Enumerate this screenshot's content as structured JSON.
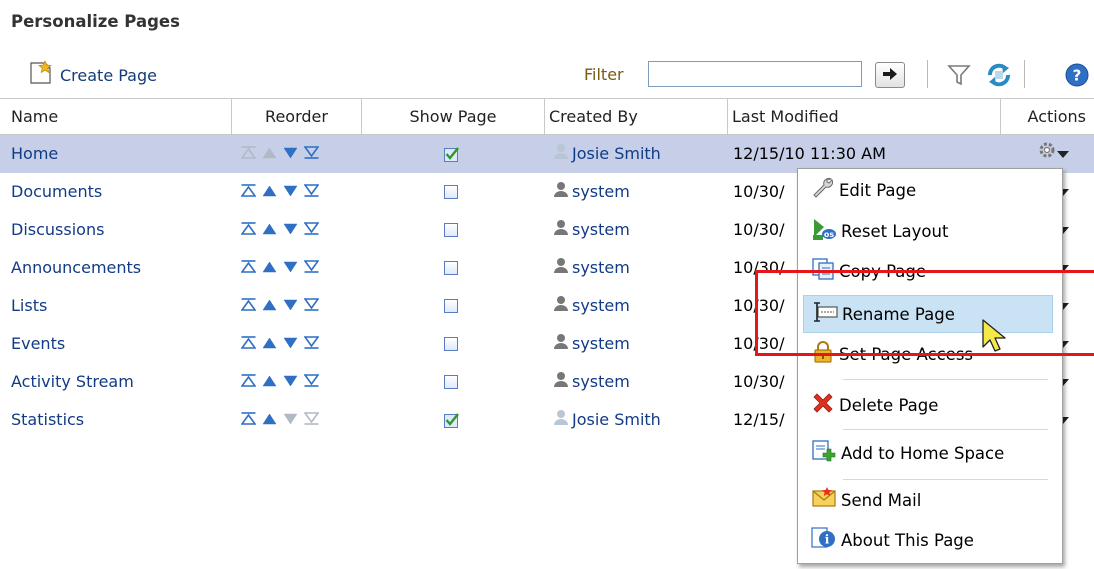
{
  "page": {
    "title": "Personalize Pages"
  },
  "toolbar": {
    "create_label": "Create Page",
    "filter_label": "Filter",
    "filter_value": "",
    "icons": [
      "create-page-icon",
      "go-arrow-icon",
      "filter-funnel-icon",
      "refresh-icon",
      "help-icon"
    ]
  },
  "columns": {
    "name": "Name",
    "reorder": "Reorder",
    "show": "Show Page",
    "created": "Created By",
    "modified": "Last Modified",
    "actions": "Actions"
  },
  "rows": [
    {
      "name": "Home",
      "created": "Josie Smith",
      "modified": "12/15/10 11:30 AM",
      "show": true,
      "selected": true
    },
    {
      "name": "Documents",
      "created": "system",
      "modified": "10/30/",
      "show": false
    },
    {
      "name": "Discussions",
      "created": "system",
      "modified": "10/30/",
      "show": false
    },
    {
      "name": "Announcements",
      "created": "system",
      "modified": "10/30/",
      "show": false
    },
    {
      "name": "Lists",
      "created": "system",
      "modified": "10/30/",
      "show": false
    },
    {
      "name": "Events",
      "created": "system",
      "modified": "10/30/",
      "show": false
    },
    {
      "name": "Activity Stream",
      "created": "system",
      "modified": "10/30/",
      "show": false
    },
    {
      "name": "Statistics",
      "created": "Josie Smith",
      "modified": "12/15/",
      "show": true
    }
  ],
  "menu": {
    "items": [
      {
        "label": "Edit Page",
        "icon": "wrench-icon"
      },
      {
        "label": "Reset Layout",
        "icon": "reset-layout-icon"
      },
      {
        "label": "Copy Page",
        "icon": "copy-icon"
      },
      {
        "label": "Rename Page",
        "icon": "rename-icon"
      },
      {
        "label": "Set Page Access",
        "icon": "lock-icon"
      },
      {
        "label": "Delete Page",
        "icon": "delete-x-icon"
      },
      {
        "label": "Add to Home Space",
        "icon": "add-home-icon"
      },
      {
        "label": "Send Mail",
        "icon": "mail-icon"
      },
      {
        "label": "About This Page",
        "icon": "info-icon"
      }
    ]
  },
  "colors": {
    "link": "#123B86",
    "selected_row": "#c6cfe7",
    "menu_highlight": "#c9e3f4",
    "callout": "#e3161c"
  }
}
